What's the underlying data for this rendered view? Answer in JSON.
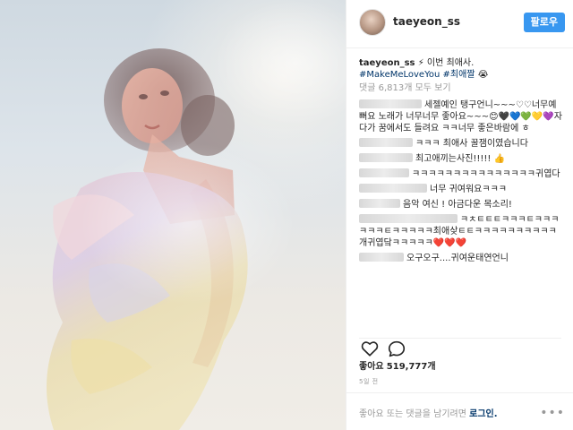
{
  "header": {
    "username": "taeyeon_ss",
    "follow_label": "팔로우"
  },
  "caption": {
    "author": "taeyeon_ss",
    "emoji": "⚡",
    "text": "이번 최애사.",
    "tag1": "#MakeMeLoveYou",
    "tag2": "#최애짤",
    "tag_emoji": "😭"
  },
  "view_all": "댓글 6,813개 모두 보기",
  "comments": [
    {
      "text": "세젤예인 탱구언니~~~♡♡너무예뻐요 노래가 너무너무 좋아요~~~😊🖤💙💚💛💜자다가 꿈에서도 들려요 ㅋㅋ너무 좋은바람에 ㅎ"
    },
    {
      "text": "ㅋㅋㅋ 최애사 꿀잼이였습니다"
    },
    {
      "text": "최고애끼는사진!!!!! 👍"
    },
    {
      "text": "ㅋㅋㅋㅋㅋㅋㅋㅋㅋㅋㅋㅋㅋㅋㅋ귀엽다"
    },
    {
      "text": "너무 귀여워요ㅋㅋㅋ"
    },
    {
      "text": "음악 여신 ! 아금다운 목소리!"
    },
    {
      "text": "ㅋㅊㅌㅌㅌㅋㅋㅋㅌㅋㅋㅋㅋㅋㅋㅌㅋㅋㅋㅋㅋ최애샂ㅌㅌㅋㅋㅋㅋㅋㅋㅋㅋㅋㅋ개귀엽닼ㅋㅋㅋㅋㅋ❤️❤️❤️"
    },
    {
      "text": "오구오구....귀여운태연언니"
    }
  ],
  "actions": {
    "like_icon": "heart-icon",
    "comment_icon": "comment-icon"
  },
  "likes": {
    "label": "좋아요",
    "count": "519,777개"
  },
  "timestamp": "5일 전",
  "footer": {
    "prompt": "좋아요 또는 댓글을 남기려면",
    "login": "로그인.",
    "more_icon": "more-options-icon"
  },
  "colors": {
    "accent": "#3897f0",
    "link": "#003569",
    "muted": "#999999"
  }
}
